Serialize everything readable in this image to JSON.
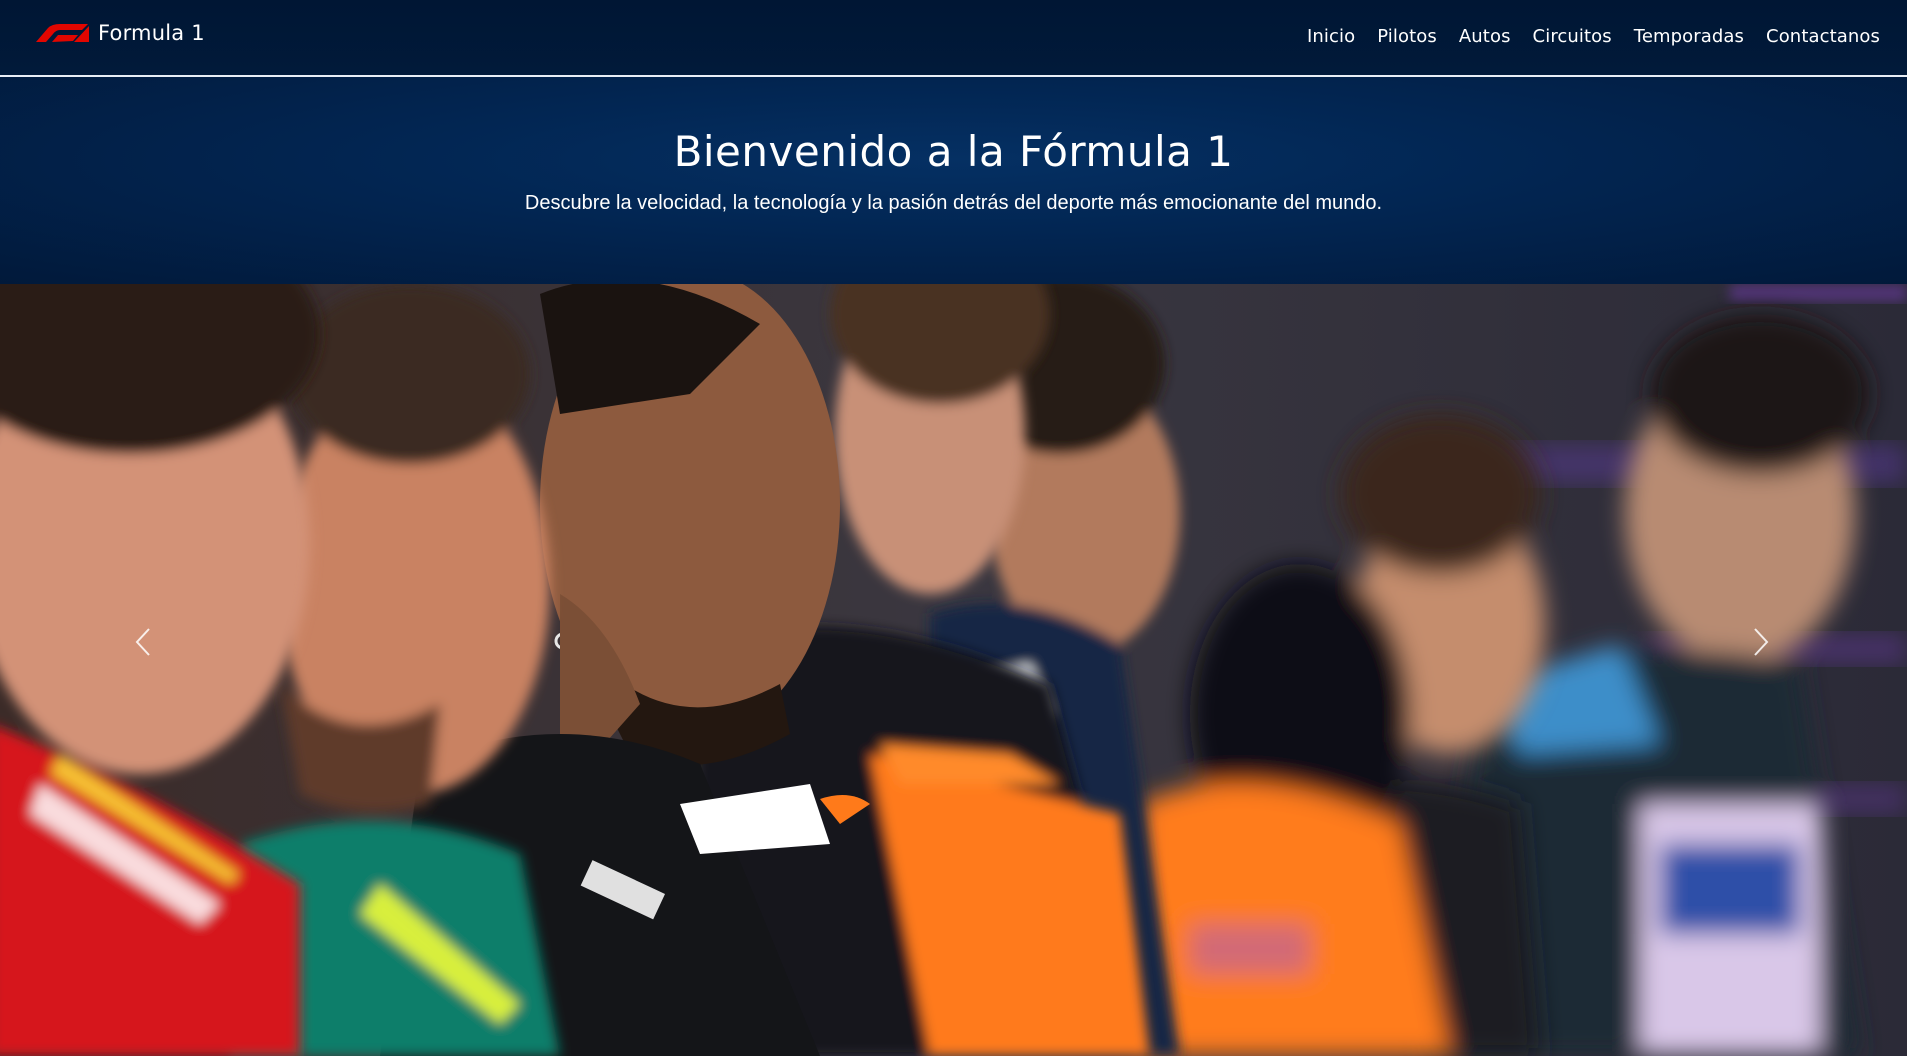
{
  "brand": {
    "name": "Formula 1",
    "logo_icon": "f1-logo-icon",
    "logo_color": "#e10600"
  },
  "nav": {
    "items": [
      {
        "label": "Inicio"
      },
      {
        "label": "Pilotos"
      },
      {
        "label": "Autos"
      },
      {
        "label": "Circuitos"
      },
      {
        "label": "Temporadas"
      },
      {
        "label": "Contactanos"
      }
    ]
  },
  "hero": {
    "title": "Bienvenido a la Fórmula 1",
    "subtitle": "Descubre la velocidad, la tecnología y la pasión detrás del deporte más emocionante del mundo."
  },
  "carousel": {
    "prev_icon": "chevron-left-icon",
    "next_icon": "chevron-right-icon"
  },
  "colors": {
    "navbar_bg": "#001634",
    "hero_bg": "#022653",
    "text": "#ffffff",
    "accent": "#e10600"
  }
}
